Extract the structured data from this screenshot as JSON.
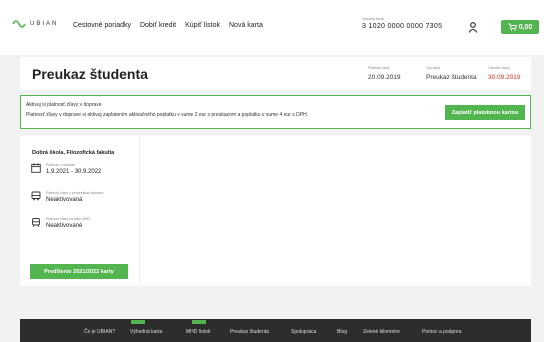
{
  "header": {
    "logo_text": "UBIAN",
    "nav": [
      "Cestovné poriadky",
      "Dobiť kredit",
      "Kúpiť lístok",
      "Nová karta"
    ],
    "card_label": "Vybraná karta",
    "card_number": "3 1020 0000 0000 7305",
    "cart_value": "0,00"
  },
  "title_bar": {
    "title": "Preukaz študenta",
    "meta": [
      {
        "label": "Platnosť karty",
        "value": "20.09.2019"
      },
      {
        "label": "Typ karty",
        "value": "Preukaz študenta"
      },
      {
        "label": "Obnoviť zľavy",
        "value": "30.09.2019"
      }
    ]
  },
  "banner": {
    "line1": "Aktivuj si platnosť zľavy v doprave",
    "line2": "Platnosť zľavy v doprave si aktivuj zaplatením aktivačného poplatku v sume 2 eur s preukazom a poplatku v sume 4 eur s DPH.",
    "button": "Zaplatiť platobnou kartou"
  },
  "side_card": {
    "faculty": "Dobrá škola, Filozofická fakulta",
    "validity_label": "Platnosť v doprave",
    "validity": "1.9.2021 - 30.9.2022",
    "transport_label": "Platnosť zľavy v prímestskej doprave",
    "transport_status": "Neaktivovaná",
    "mhd_label": "Platnosť zľavy na linky MHD",
    "mhd_status": "Neaktivované",
    "button": "Predĺženie 2021/2022 karty"
  },
  "footer": {
    "items": [
      "Čo je UBIAN?",
      "Výhodná karta",
      "MHD lístok",
      "Preukaz študenta",
      "Spolupráca",
      "Blog",
      "Zelené kilometre",
      "Pomoc a podpora"
    ]
  },
  "colors": {
    "accent": "#53b550",
    "alert": "#e0301e",
    "footer": "#2d2d2d"
  }
}
